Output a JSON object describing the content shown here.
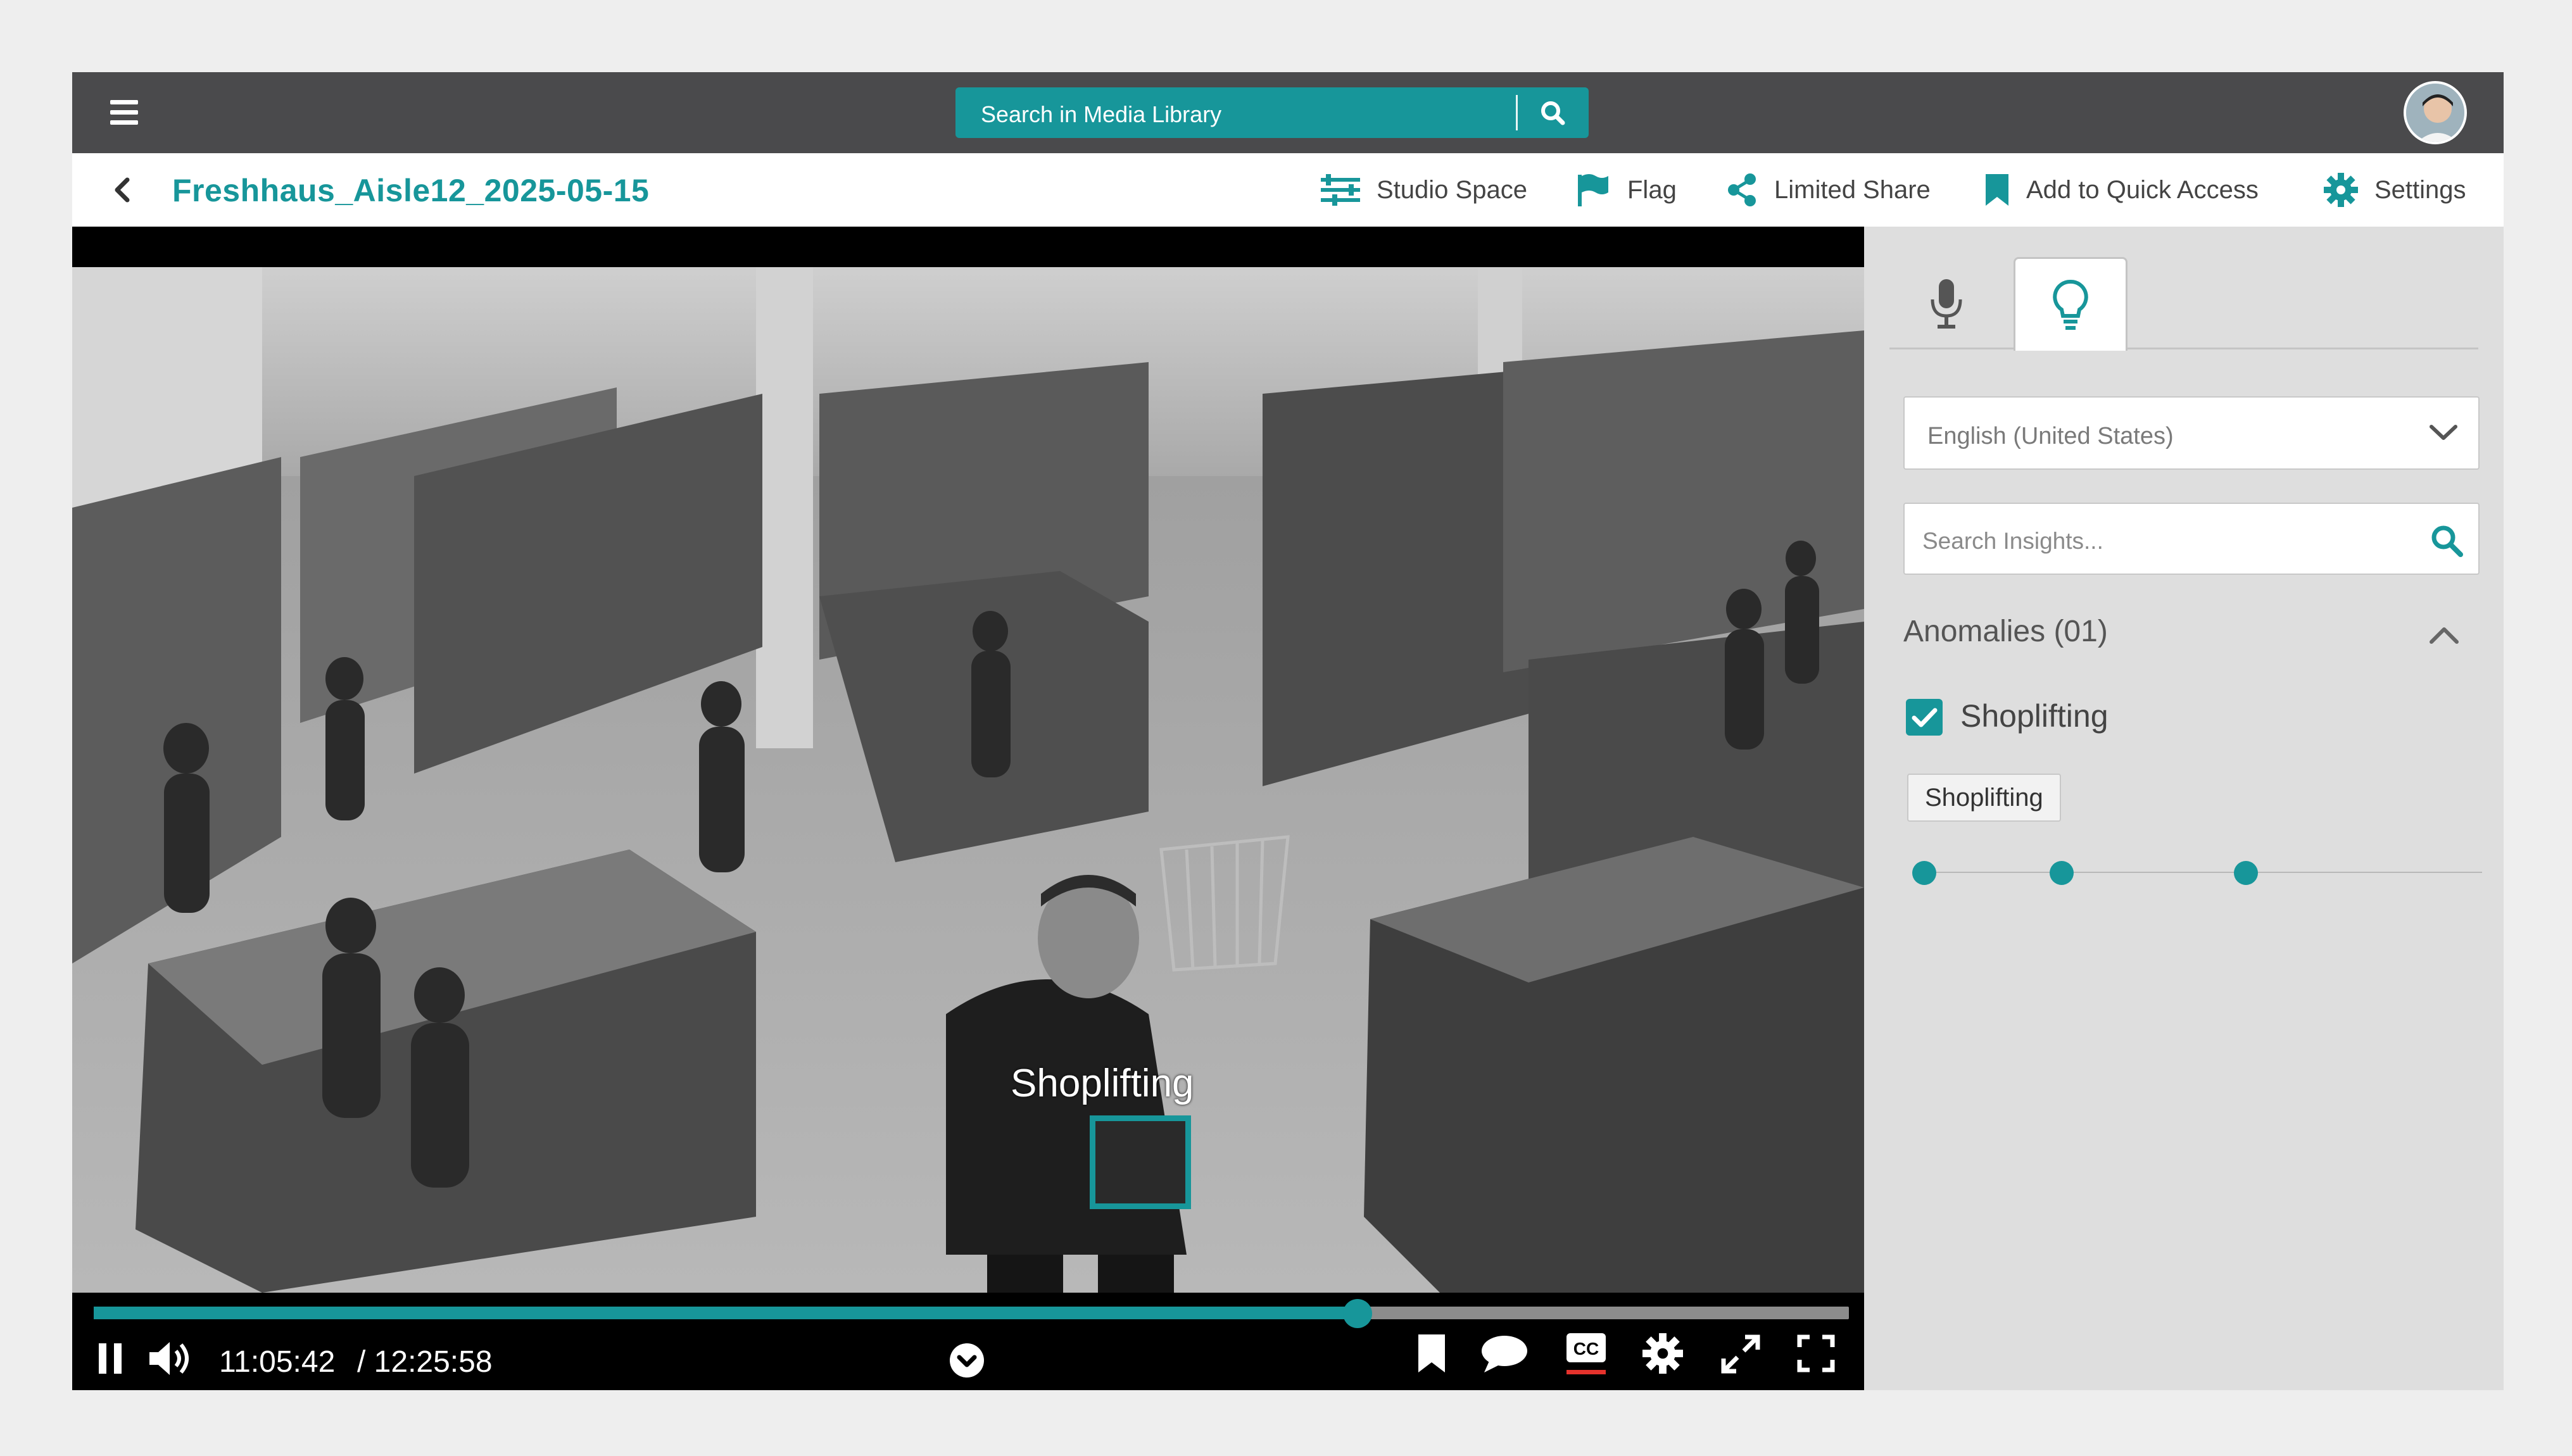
{
  "app": {
    "search_placeholder": "Search in Media Library",
    "title": "Freshhaus_Aisle12_2025-05-15",
    "accent_color": "#17969a"
  },
  "toolbar": {
    "items": [
      {
        "label": "Studio Space",
        "icon": "sliders-icon"
      },
      {
        "label": "Flag",
        "icon": "flag-icon"
      },
      {
        "label": "Limited Share",
        "icon": "share-icon"
      },
      {
        "label": "Add to Quick Access",
        "icon": "bookmark-icon"
      },
      {
        "label": "Settings",
        "icon": "gear-icon"
      }
    ]
  },
  "video": {
    "overlay_label": "Shoplifting",
    "current_time": "11:05:42",
    "duration_text": "/ 12:25:58",
    "progress_fraction": 0.72,
    "controls": [
      "pause-icon",
      "volume-icon",
      "chevron-down-circle-icon",
      "bookmark-icon",
      "comment-icon",
      "closed-captions-icon",
      "gear-icon",
      "expand-icon",
      "fullscreen-icon"
    ]
  },
  "side_panel": {
    "tabs": [
      {
        "icon": "microphone-icon",
        "active": false
      },
      {
        "icon": "lightbulb-icon",
        "active": true
      }
    ],
    "language": "English (United States)",
    "insights_placeholder": "Search Insights...",
    "section_title": "Anomalies (01)",
    "anomaly_label": "Shoplifting",
    "anomaly_checked": true,
    "chip_label": "Shoplifting",
    "timeline_markers": 3
  }
}
